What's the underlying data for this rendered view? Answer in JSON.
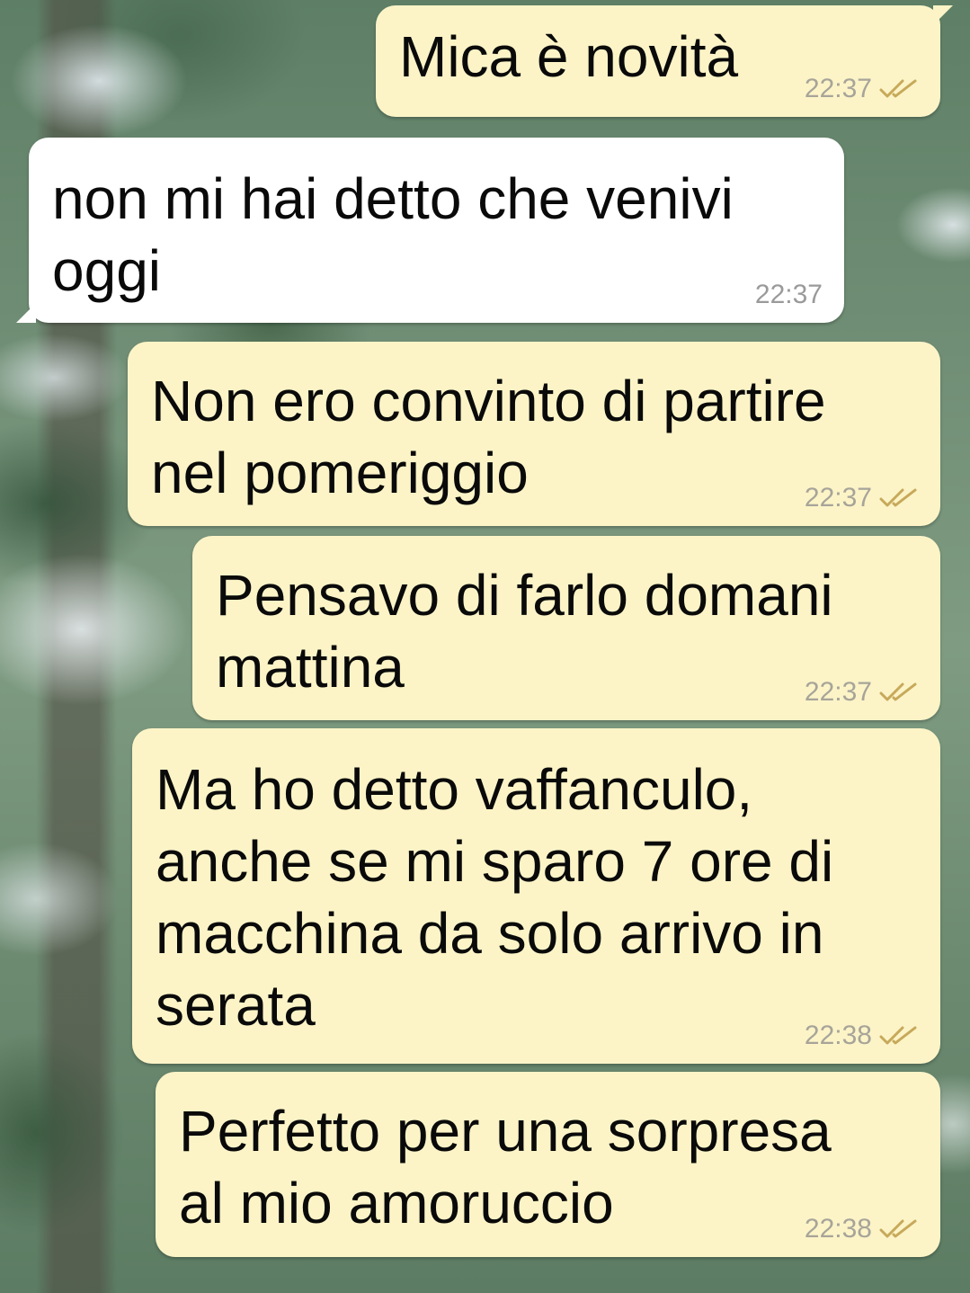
{
  "messages": [
    {
      "text": "Mica è novità",
      "time": "22:37",
      "ticks": "double-check-icon"
    },
    {
      "text": "non mi hai detto che venivi\noggi",
      "time": "22:37"
    },
    {
      "text": "Non ero convinto di partire\nnel pomeriggio",
      "time": "22:37",
      "ticks": "double-check-icon"
    },
    {
      "text": "Pensavo di farlo domani\nmattina",
      "time": "22:37",
      "ticks": "double-check-icon"
    },
    {
      "text": "Ma ho detto vaffanculo,\nanche se mi sparo 7 ore di\nmacchina da solo arrivo in\nserata",
      "time": "22:38",
      "ticks": "double-check-icon"
    },
    {
      "text": "Perfetto per una sorpresa\nal mio amoruccio",
      "time": "22:38",
      "ticks": "double-check-icon"
    }
  ],
  "colors": {
    "outgoing_bubble": "#fcf4c7",
    "incoming_bubble": "#ffffff",
    "tick": "#c7a95a",
    "time": "#a7a499"
  }
}
